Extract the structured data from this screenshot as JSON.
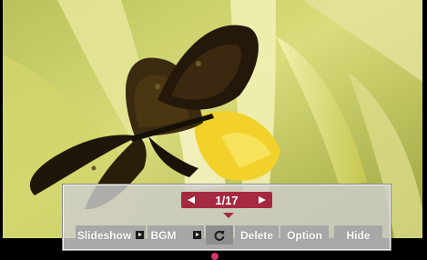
{
  "pager": {
    "current": "1/17"
  },
  "controls": {
    "slideshow_label": "Slideshow",
    "bgm_label": "BGM",
    "delete_label": "Delete",
    "option_label": "Option",
    "hide_label": "Hide"
  },
  "icons": {
    "prev": "triangle-left",
    "next": "triangle-right",
    "play": "play-square",
    "rotate": "rotate-arrow"
  },
  "colors": {
    "accent": "#a52a41",
    "button": "#a7a7a7",
    "panel": "#cdcdcd",
    "indicator": "#d6336c"
  }
}
